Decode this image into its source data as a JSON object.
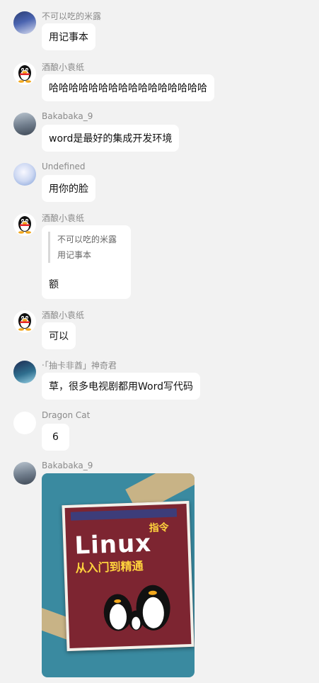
{
  "messages": [
    {
      "sender": "不可以吃的米露",
      "text": "用记事本"
    },
    {
      "sender": "酒酿小袁纸",
      "text": "哈哈哈哈哈哈哈哈哈哈哈哈哈哈哈哈"
    },
    {
      "sender": "Bakabaka_9",
      "text": "word是最好的集成开发环境"
    },
    {
      "sender": "Undefined",
      "text": "用你的脸"
    },
    {
      "sender": "酒酿小袁纸",
      "quote_sender": "不可以吃的米露",
      "quote_text": "用记事本",
      "text": "额"
    },
    {
      "sender": "酒酿小袁纸",
      "text": "可以"
    },
    {
      "sender": "‧「抽卡非酋」神奇君",
      "text": "草，很多电视剧都用Word写代码"
    },
    {
      "sender": "Dragon Cat",
      "text": "6"
    },
    {
      "sender": "Bakabaka_9",
      "image": {
        "book_title": "Linux",
        "book_subtitle": "从入门到精通",
        "book_badge": "指令"
      }
    }
  ],
  "icons": {
    "qq": "penguin-icon",
    "colors": {
      "bubble": "#ffffff",
      "background": "#f2f2f2",
      "name": "#8a8a8a"
    }
  }
}
